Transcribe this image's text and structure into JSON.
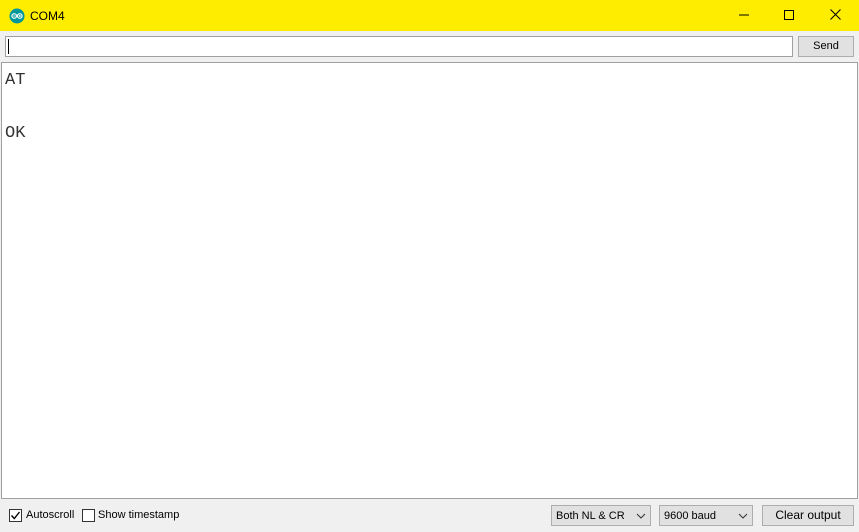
{
  "window": {
    "title": "COM4",
    "accent_color": "#ffed00"
  },
  "send_bar": {
    "input_value": "",
    "send_label": "Send"
  },
  "output": {
    "lines": [
      "AT",
      "",
      "OK"
    ]
  },
  "footer": {
    "autoscroll_label": "Autoscroll",
    "autoscroll_checked": true,
    "timestamp_label": "Show timestamp",
    "timestamp_checked": false,
    "line_ending_value": "Both NL & CR",
    "baud_value": "9600 baud",
    "clear_label": "Clear output"
  },
  "icons": {
    "app": "arduino-logo-icon",
    "minimize": "minimize-icon",
    "maximize": "maximize-icon",
    "close": "close-icon",
    "dropdown": "chevron-down-icon",
    "check": "checkmark-icon"
  }
}
